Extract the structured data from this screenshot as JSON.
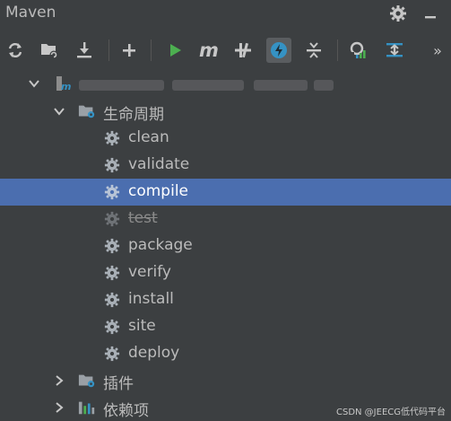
{
  "window": {
    "title": "Maven"
  },
  "title_icons": [
    "gear-icon",
    "minimize-icon"
  ],
  "toolbar": {
    "more_label": "»"
  },
  "tree": {
    "lifecycle_label": "生命周期",
    "phases": [
      {
        "label": "clean"
      },
      {
        "label": "validate"
      },
      {
        "label": "compile"
      },
      {
        "label": "test"
      },
      {
        "label": "package"
      },
      {
        "label": "verify"
      },
      {
        "label": "install"
      },
      {
        "label": "site"
      },
      {
        "label": "deploy"
      }
    ],
    "selected_phase": "compile",
    "skipped_phase": "test",
    "plugins_label": "插件",
    "dependencies_label": "依赖项"
  },
  "colors": {
    "background": "#3c3f41",
    "selection": "#4b6eaf",
    "run_green": "#4caf50",
    "accent_blue": "#3592c4"
  },
  "watermark": "CSDN @JEECG低代码平台"
}
